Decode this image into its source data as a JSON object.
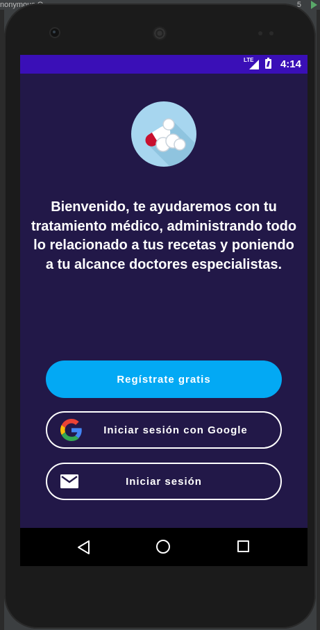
{
  "ide": {
    "tab_text": "nonymous O",
    "right_text": "5"
  },
  "status_bar": {
    "network": "LTE",
    "time": "4:14"
  },
  "app": {
    "logo_icon": "pills-icon",
    "welcome_text": "Bienvenido, te ayudaremos con tu tratamiento médico, administrando todo lo relacionado a tus recetas y poniendo a tu alcance doctores especialistas.",
    "register_button": "Regístrate gratis",
    "google_button": "Iniciar sesión con Google",
    "login_button": "Iniciar sesión"
  },
  "colors": {
    "status_bar": "#3a0fb7",
    "background": "#221848",
    "primary_button": "#03a9f4",
    "logo_circle": "#a7d6ef"
  },
  "nav_bar": {
    "icons": [
      "back-icon",
      "home-icon",
      "recents-icon"
    ]
  }
}
